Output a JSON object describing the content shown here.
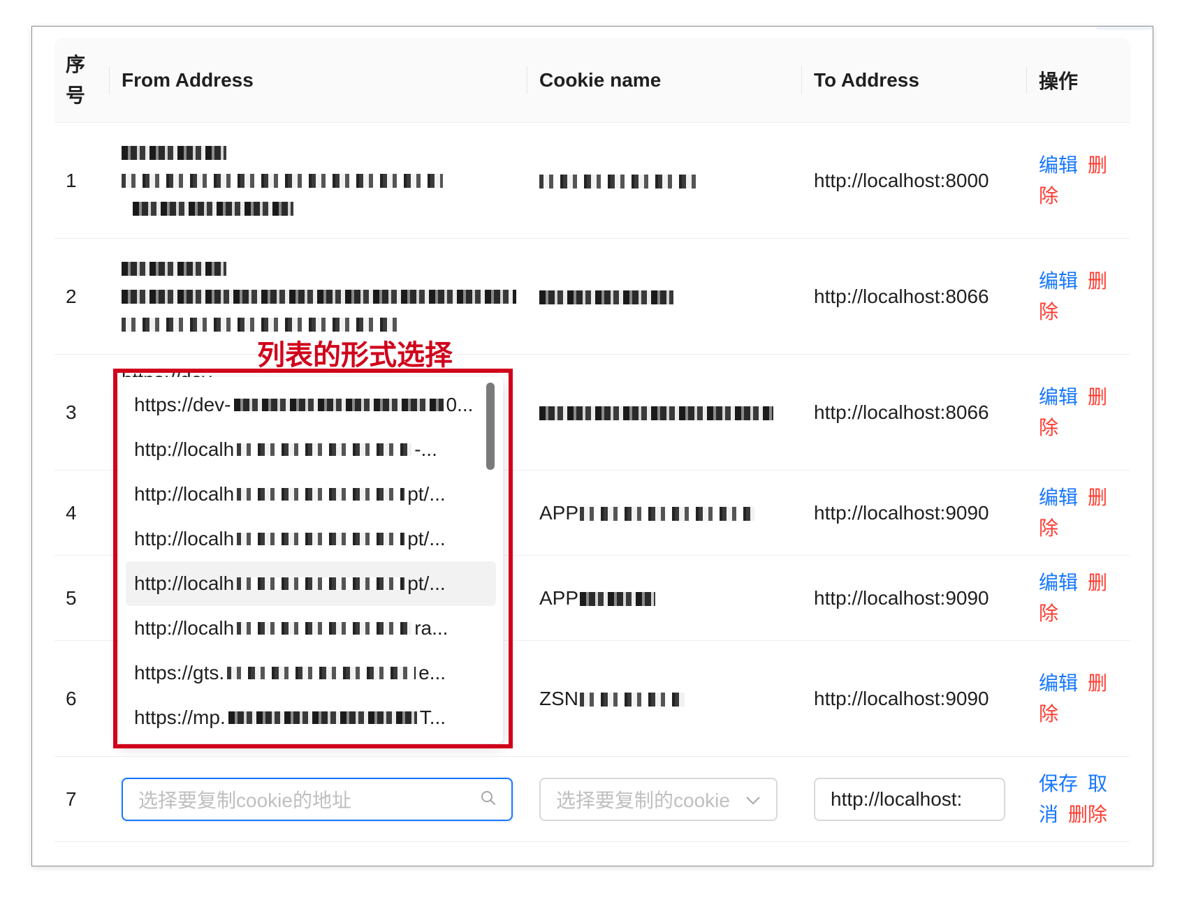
{
  "table": {
    "headers": {
      "seq": "序号",
      "from": "From Address",
      "cookie": "Cookie name",
      "to": "To Address",
      "ops": "操作"
    },
    "rows": [
      {
        "seq": "1",
        "from_prefix": "",
        "cookie_prefix": "",
        "to": "http://localhost:8000"
      },
      {
        "seq": "2",
        "from_prefix": "",
        "cookie_prefix": "",
        "to": "http://localhost:8066"
      },
      {
        "seq": "3",
        "from_prefix": "https://dev-",
        "cookie_prefix": "",
        "to": "http://localhost:8066"
      },
      {
        "seq": "4",
        "from_prefix": "",
        "cookie_prefix": "APP",
        "to": "http://localhost:9090"
      },
      {
        "seq": "5",
        "from_prefix": "",
        "cookie_prefix": "APP",
        "to": "http://localhost:9090"
      },
      {
        "seq": "6",
        "from_prefix": "",
        "cookie_prefix": "ZSN",
        "to": "http://localhost:9090"
      }
    ],
    "op_edit": "编辑",
    "op_delete": "删除",
    "new_row": {
      "seq": "7",
      "from_placeholder": "选择要复制cookie的地址",
      "cookie_placeholder": "选择要复制的cookie",
      "to_value": "http://localhost:",
      "op_save": "保存",
      "op_cancel": "取消",
      "op_delete": "删除"
    }
  },
  "dropdown": {
    "options": [
      {
        "prefix": "https://dev-",
        "suffix": "0..."
      },
      {
        "prefix": "http://localh",
        "suffix": "-..."
      },
      {
        "prefix": "http://localh",
        "suffix": "pt/..."
      },
      {
        "prefix": "http://localh",
        "suffix": "pt/..."
      },
      {
        "prefix": "http://localh",
        "suffix": "pt/..."
      },
      {
        "prefix": "http://localh",
        "suffix": "ra..."
      },
      {
        "prefix": "https://gts.",
        "suffix": "e..."
      },
      {
        "prefix": "https://mp.",
        "suffix": "T..."
      }
    ],
    "active_index": 4
  },
  "annotation": {
    "label": "列表的形式选择",
    "color": "#d0021b"
  },
  "colors": {
    "link_blue": "#1677ff",
    "delete_red": "#ff3b30",
    "focus_blue": "#1677ff"
  },
  "icons": {
    "search": "search-icon",
    "chevron": "chevron-down-icon"
  }
}
